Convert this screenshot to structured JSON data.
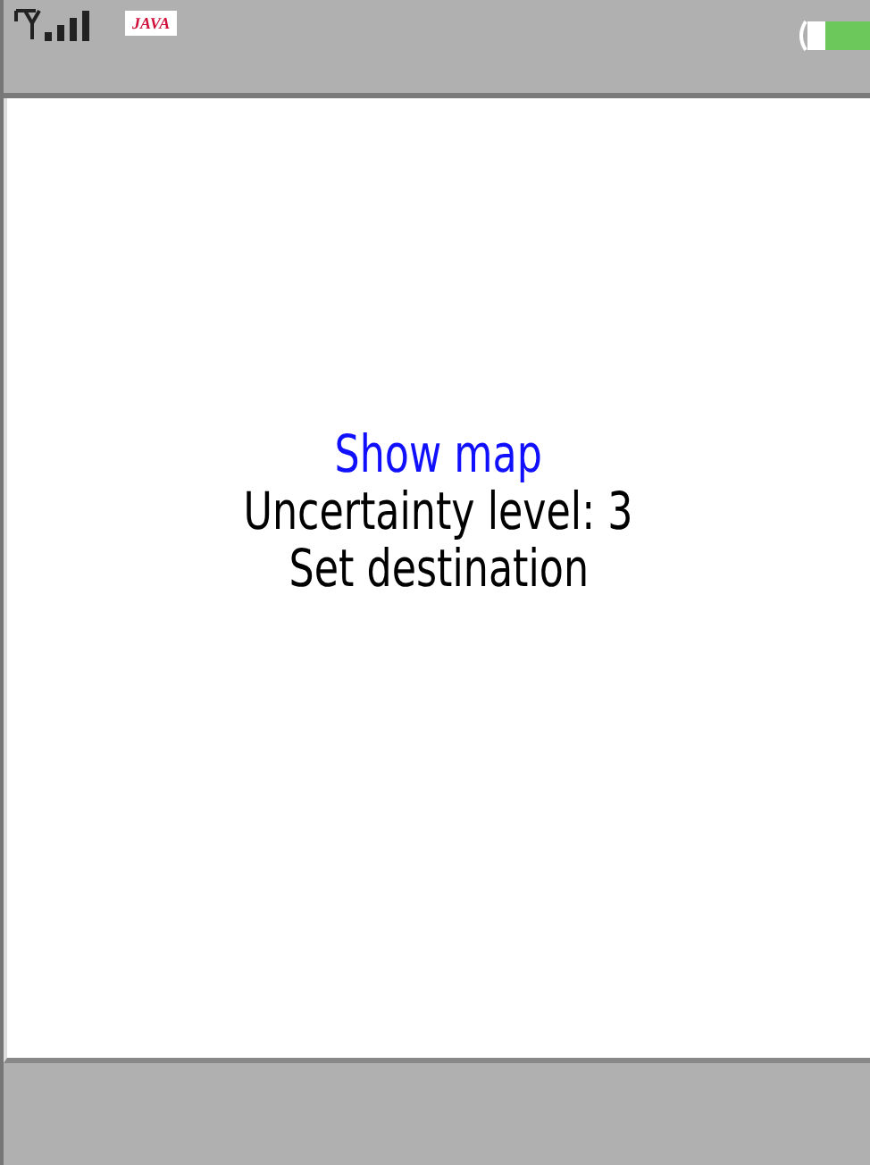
{
  "status_bar": {
    "java_badge": "JAVA"
  },
  "menu": [
    {
      "label": "Show map",
      "selected": true
    },
    {
      "label": "Uncertainty level: 3",
      "selected": false
    },
    {
      "label": "Set destination",
      "selected": false
    }
  ]
}
